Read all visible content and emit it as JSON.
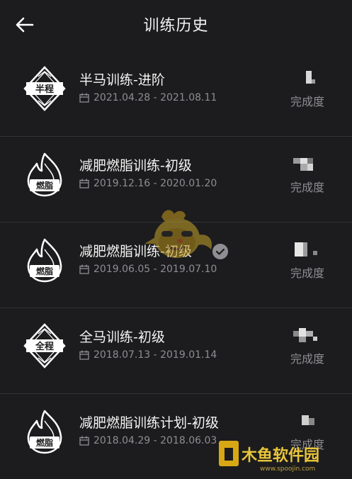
{
  "header": {
    "title": "训练历史"
  },
  "items": [
    {
      "badge": "半程",
      "badge_icon": "diamond-medal-icon",
      "name": "半马训练-进阶",
      "date": "2021.04.28 - 2021.08.11",
      "progress_label": "完成度",
      "completed": false
    },
    {
      "badge": "燃脂",
      "badge_icon": "flame-icon",
      "name": "减肥燃脂训练-初级",
      "date": "2019.12.16 - 2020.01.20",
      "progress_label": "完成度",
      "completed": false
    },
    {
      "badge": "燃脂",
      "badge_icon": "flame-icon",
      "name": "减肥燃脂训练-初级",
      "date": "2019.06.05 - 2019.07.10",
      "progress_label": "完成度",
      "completed": true
    },
    {
      "badge": "全程",
      "badge_icon": "diamond-medal-icon",
      "name": "全马训练-初级",
      "date": "2018.07.13 - 2019.01.14",
      "progress_label": "完成度",
      "completed": false
    },
    {
      "badge": "燃脂",
      "badge_icon": "flame-icon",
      "name": "减肥燃脂训练计划-初级",
      "date": "2018.04.29 - 2018.06.03",
      "progress_label": "完成度",
      "completed": false
    }
  ],
  "watermark": {
    "text": "木鱼软件园"
  },
  "colors": {
    "background": "#1c1c1e",
    "secondary_text": "#8e8e93",
    "divider": "#333336"
  }
}
